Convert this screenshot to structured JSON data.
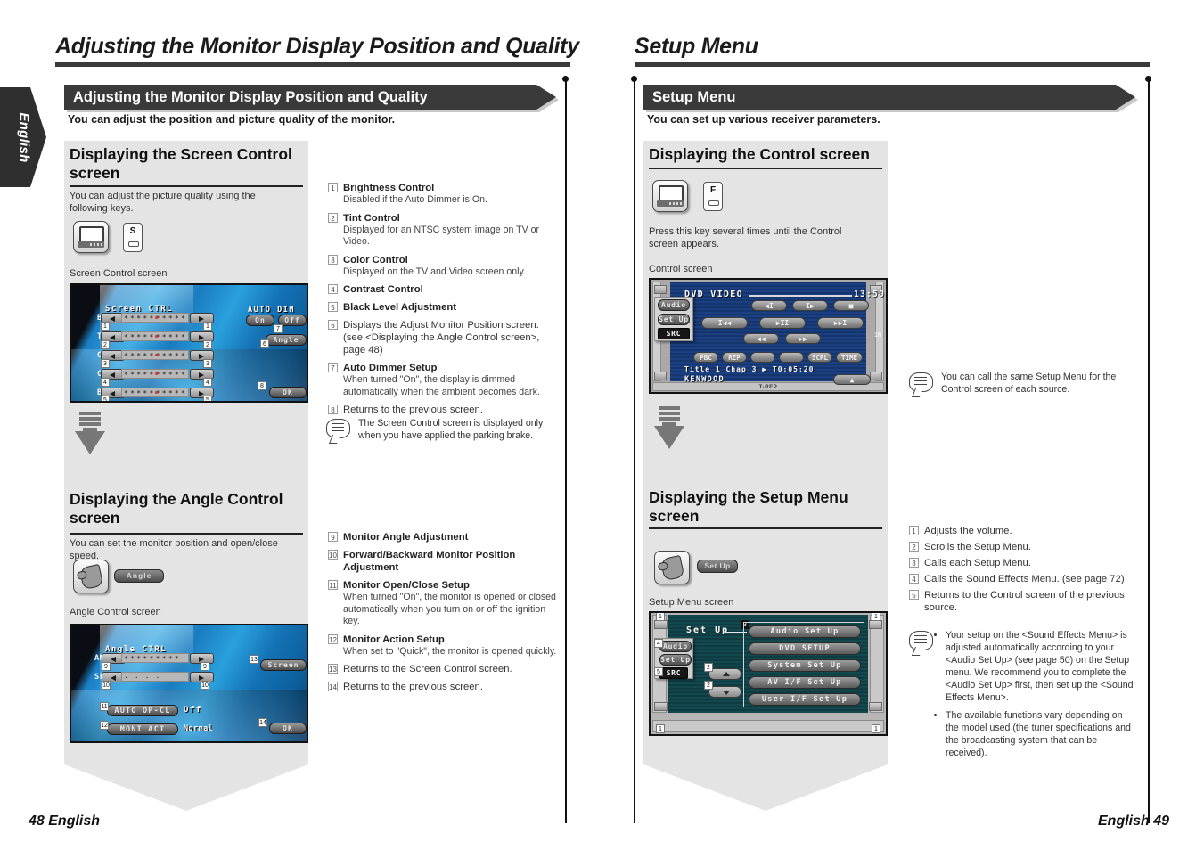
{
  "side_tab": {
    "label": "English"
  },
  "left_page": {
    "running_head": "Adjusting the Monitor Display Position and Quality",
    "banner": "Adjusting the Monitor Display Position and Quality",
    "lede": "You can adjust the position and picture quality of the monitor.",
    "section1": {
      "heading": "Displaying the Screen Control screen",
      "intro": "You can adjust the picture quality using the following keys.",
      "keys": {
        "monitor_key": "monitor-key-icon",
        "s_key_letter": "S"
      },
      "caption": "Screen Control screen",
      "screen": {
        "title": "Screen CTRL",
        "rows": [
          {
            "label": "BRT",
            "num": "1"
          },
          {
            "label": "TIN",
            "num": "2"
          },
          {
            "label": "COL",
            "num": "3"
          },
          {
            "label": "CONT",
            "num": "4"
          },
          {
            "label": "BLK",
            "num": "5"
          }
        ],
        "auto_dim_label": "AUTO DIM",
        "auto_dim_on": "On",
        "auto_dim_off": "Off",
        "angle_btn": "Angle",
        "ok_btn": "OK",
        "callouts": {
          "auto_dim": "7",
          "angle": "6",
          "ok": "8"
        }
      }
    },
    "section2": {
      "heading": "Displaying the Angle Control screen",
      "intro": "You can set the monitor position and open/close speed.",
      "key_button": "Angle",
      "caption": "Angle Control screen",
      "screen": {
        "title": "Angle CTRL",
        "rows": [
          {
            "label": "ANG",
            "num": "9"
          },
          {
            "label": "SLD",
            "num": "10"
          }
        ],
        "auto_opcl_label": "AUTO OP-CL",
        "auto_opcl_value": "Off",
        "moni_act_label": "MONI ACT",
        "moni_act_value": "Normal",
        "screen_btn": "Screen",
        "ok_btn": "OK",
        "callouts": {
          "auto_opcl": "11",
          "moni_act": "12",
          "screen": "13",
          "ok": "14"
        }
      }
    },
    "items": [
      {
        "n": "1",
        "title": "Brightness Control",
        "desc": "Disabled if the Auto Dimmer is On."
      },
      {
        "n": "2",
        "title": "Tint Control",
        "desc": "Displayed for an NTSC system image on TV or Video."
      },
      {
        "n": "3",
        "title": "Color Control",
        "desc": "Displayed on the TV and Video screen only."
      },
      {
        "n": "4",
        "title": "Contrast Control",
        "desc": ""
      },
      {
        "n": "5",
        "title": "Black Level Adjustment",
        "desc": ""
      },
      {
        "n": "6",
        "title": "",
        "desc": "Displays the Adjust Monitor Position screen. (see <Displaying the Angle Control screen>, page 48)"
      },
      {
        "n": "7",
        "title": "Auto Dimmer Setup",
        "desc": "When turned \"On\", the display is dimmed automatically when the ambient becomes dark."
      },
      {
        "n": "8",
        "title": "",
        "desc": "Returns to the previous screen."
      }
    ],
    "note": "The Screen Control screen is displayed only when you have applied the parking brake.",
    "items2": [
      {
        "n": "9",
        "title": "Monitor Angle Adjustment",
        "desc": ""
      },
      {
        "n": "10",
        "title": "Forward/Backward Monitor Position Adjustment",
        "desc": ""
      },
      {
        "n": "11",
        "title": "Monitor Open/Close Setup",
        "desc": "When turned \"On\", the monitor is opened or closed automatically when you turn on or off the ignition key."
      },
      {
        "n": "12",
        "title": "Monitor Action Setup",
        "desc": "When set to \"Quick\", the monitor is opened quickly."
      },
      {
        "n": "13",
        "title": "",
        "desc": "Returns to the Screen Control screen."
      },
      {
        "n": "14",
        "title": "",
        "desc": "Returns to the previous screen."
      }
    ],
    "folio": "48 English"
  },
  "right_page": {
    "running_head": "Setup Menu",
    "banner": "Setup Menu",
    "lede": "You can set up various receiver parameters.",
    "section1": {
      "heading": "Displaying the Control screen",
      "keys": {
        "monitor_key": "monitor-key-icon",
        "f_key_letter": "F"
      },
      "intro": "Press this key several times until the Control screen appears.",
      "caption": "Control screen",
      "screen": {
        "source": "DVD VIDEO",
        "clock": "13:50",
        "menu": [
          "Audio",
          "Set Up",
          "SRC"
        ],
        "transport_row1": [
          "◀I",
          "I▶",
          "■"
        ],
        "transport_row2": [
          "I◀◀",
          "▶II",
          "▶▶I"
        ],
        "transport_row3": [
          "◀◀",
          "▶▶"
        ],
        "func_row": [
          "PBC",
          "REP",
          "",
          "",
          "SCRL",
          "TIME"
        ],
        "info_line": "Title 1   Chap   3   ▶   T0:05:20",
        "brand": "KENWOOD",
        "status_bar": "T-REP",
        "eject": "▲",
        "side_label": "IN"
      }
    },
    "section2": {
      "heading": "Displaying the Setup Menu screen",
      "key_button": "Set Up",
      "caption": "Setup Menu screen",
      "screen": {
        "title": "Set Up",
        "menu": [
          "Audio",
          "Set Up",
          "SRC"
        ],
        "entries": [
          "Audio Set Up",
          "DVD SETUP",
          "System Set Up",
          "AV I/F Set Up",
          "User I/F Set Up"
        ],
        "callouts": {
          "volume": "1",
          "scroll": "2",
          "calls": "3",
          "audio": "4",
          "src": "5"
        }
      }
    },
    "note1": "You can call the same Setup Menu for the Control screen of each source.",
    "items": [
      {
        "n": "1",
        "desc": "Adjusts the volume."
      },
      {
        "n": "2",
        "desc": "Scrolls the Setup Menu."
      },
      {
        "n": "3",
        "desc": "Calls each Setup Menu."
      },
      {
        "n": "4",
        "desc": "Calls the Sound Effects Menu. (see page 72)"
      },
      {
        "n": "5",
        "desc": "Returns to the Control screen of the previous source."
      }
    ],
    "note2_bullets": [
      "Your setup on the <Sound Effects Menu> is adjusted automatically according to your <Audio Set Up> (see page 50) on the Setup menu. We recommend you to complete the <Audio Set Up> first, then set up the <Sound Effects Menu>.",
      "The available functions vary depending on the model used (the tuner specifications and the broadcasting system that can be received)."
    ],
    "folio": "English 49"
  }
}
